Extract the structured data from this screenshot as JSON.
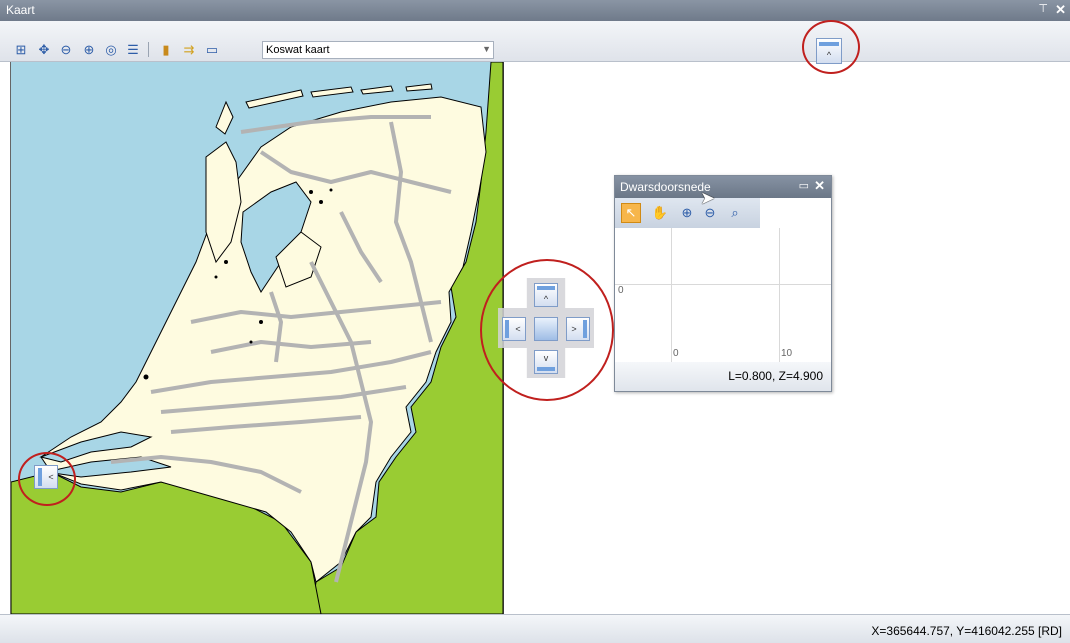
{
  "window": {
    "title": "Kaart",
    "pin_glyph": "\u0002",
    "close_glyph": "✕"
  },
  "toolbar": {
    "buttons": [
      {
        "icon": "add-layer-icon",
        "glyph": "⊞"
      },
      {
        "icon": "pan-icon",
        "glyph": "✥"
      },
      {
        "icon": "zoom-out-icon",
        "glyph": "⊖"
      },
      {
        "icon": "zoom-in-icon",
        "glyph": "⊕"
      },
      {
        "icon": "zoom-extent-icon",
        "glyph": "◎"
      },
      {
        "icon": "legend-list-icon",
        "glyph": "☰"
      },
      {
        "icon": "export-icon",
        "glyph": "▮"
      },
      {
        "icon": "import-icon",
        "glyph": "⇉"
      },
      {
        "icon": "layout-icon",
        "glyph": "▭"
      }
    ],
    "map_select": {
      "value": "Koswat kaart"
    }
  },
  "statusbar": {
    "coordinates": "X=365644.757, Y=416042.255 [RD]"
  },
  "panel": {
    "title": "Dwarsdoorsnede",
    "tools": [
      {
        "icon": "select-pointer-icon",
        "glyph": "↖"
      },
      {
        "icon": "pan-hand-icon",
        "glyph": "✋"
      },
      {
        "icon": "zoom-in-icon",
        "glyph": "⊕"
      },
      {
        "icon": "zoom-out-icon",
        "glyph": "⊖"
      },
      {
        "icon": "zoom-extent-icon",
        "glyph": "⌕"
      }
    ],
    "axis": {
      "y_tick": "0",
      "x_tick_0": "0",
      "x_tick_10": "10"
    },
    "footer": "L=0.800, Z=4.900"
  },
  "colors": {
    "water": "#a8d6e6",
    "land": "#fefbe0",
    "neighbor": "#99cc33",
    "rivers": "#b3b3b3",
    "highlight": "#c0201e"
  }
}
